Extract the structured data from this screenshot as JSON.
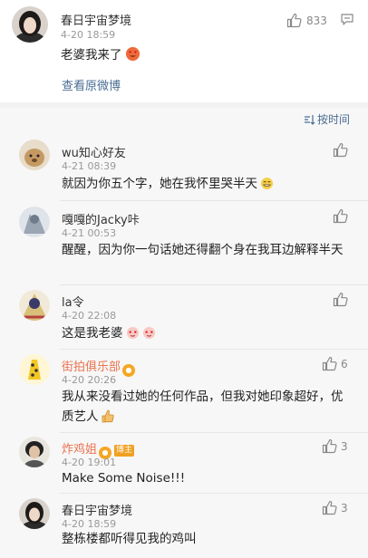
{
  "post": {
    "username": "春日宇宙梦境",
    "time": "4-20 18:59",
    "text": "老婆我来了",
    "likes": "833",
    "view_original": "查看原微博"
  },
  "sort": {
    "label": "按时间"
  },
  "comments": [
    {
      "username": "wu知心好友",
      "time": "4-21 08:39",
      "text": "就因为你五个字，她在我怀里哭半天",
      "likes": ""
    },
    {
      "username": "嘎嘎的Jacky咔",
      "time": "4-21 00:53",
      "text": "醒醒，因为你一句话她还得翻个身在我耳边解释半天",
      "likes": ""
    },
    {
      "username": "la令",
      "time": "4-20 22:08",
      "text": "这是我老婆",
      "likes": ""
    },
    {
      "username": "街拍俱乐部",
      "time": "4-20 20:26",
      "text": "我从来没看过她的任何作品，但我对她印象超好，优质艺人",
      "likes": "6"
    },
    {
      "username": "炸鸡姐",
      "time": "4-20 19:01",
      "text": "Make Some Noise!!!",
      "likes": "3",
      "badge": "博主"
    },
    {
      "username": "春日宇宙梦境",
      "time": "4-20 18:59",
      "text": "整栋楼都听得见我的鸡叫",
      "likes": "3"
    }
  ],
  "colors": {
    "link": "#4a6d94",
    "highlight_name": "#eb7350",
    "background": "#f7f7f7"
  }
}
